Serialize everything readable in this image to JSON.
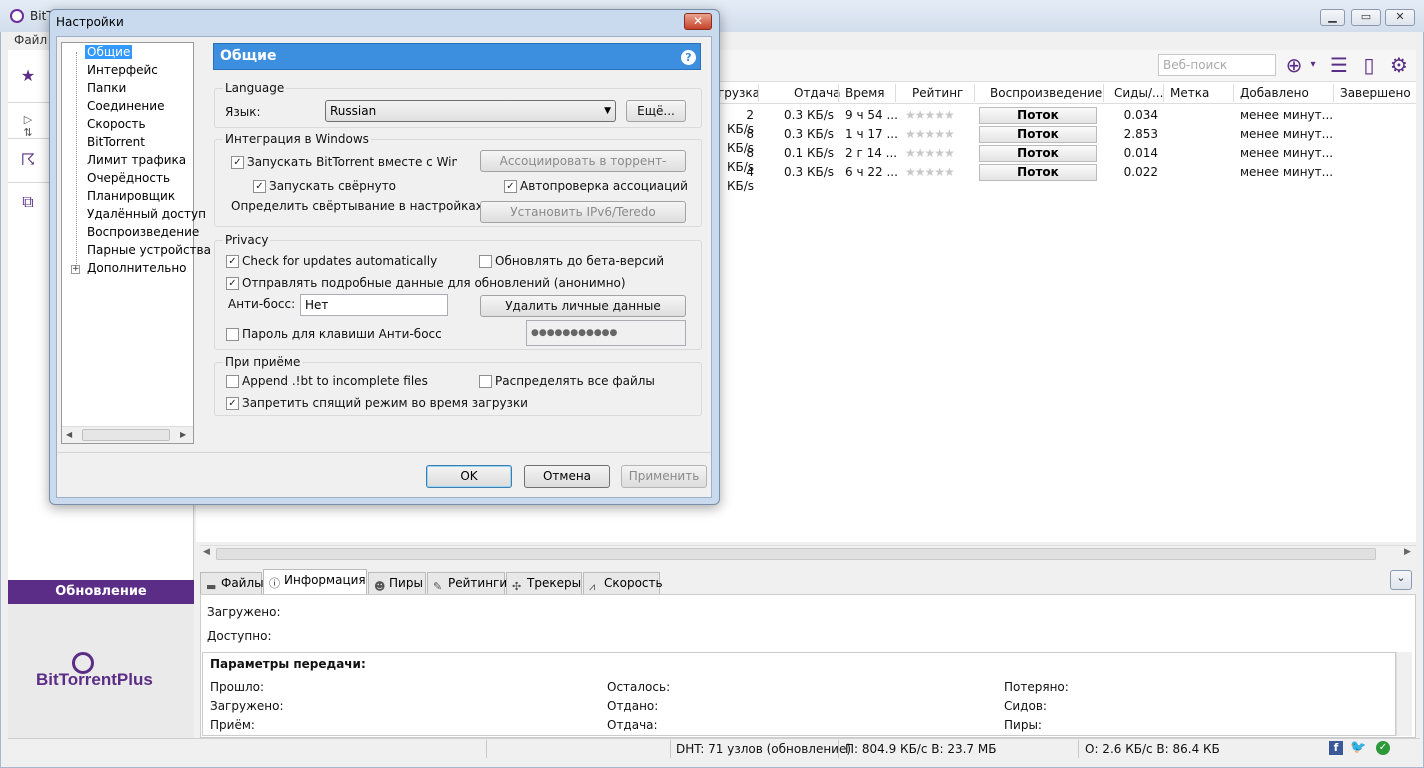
{
  "main": {
    "title": "BitTorrent",
    "menu_file": "Файл",
    "update_btn": "Обновление",
    "ad_logo": "BitTorrentPlus",
    "websearch_placeholder": "Веб-поиск"
  },
  "columns": [
    "грузка",
    "Отдача",
    "Время",
    "Рейтинг",
    "Воспроизведение",
    "Сиды/...",
    "Метка",
    "Добавлено",
    "Завершено"
  ],
  "rows": [
    {
      "dl": "2 КБ/s",
      "ul": "0.3 КБ/s",
      "time": "9 ч 54 ...",
      "stream": "Поток",
      "seeds": "0.034",
      "added": "менее минут..."
    },
    {
      "dl": "8 КБ/s",
      "ul": "0.3 КБ/s",
      "time": "1 ч 17 ...",
      "stream": "Поток",
      "seeds": "2.853",
      "added": "менее минут..."
    },
    {
      "dl": "8 КБ/s",
      "ul": "0.1 КБ/s",
      "time": "2 г 14 ...",
      "stream": "Поток",
      "seeds": "0.014",
      "added": "менее минут..."
    },
    {
      "dl": "4 КБ/s",
      "ul": "0.3 КБ/s",
      "time": "6 ч 22 ...",
      "stream": "Поток",
      "seeds": "0.022",
      "added": "менее минут..."
    }
  ],
  "stars": "★★★★★",
  "tabs": [
    "Файлы",
    "Информация",
    "Пиры",
    "Рейтинги",
    "Трекеры",
    "Скорость"
  ],
  "info": {
    "downloaded": "Загружено:",
    "available": "Доступно:",
    "params": "Параметры передачи:",
    "c1": [
      "Прошло:",
      "Загружено:",
      "Приём:"
    ],
    "c2": [
      "Осталось:",
      "Отдано:",
      "Отдача:"
    ],
    "c3": [
      "Потеряно:",
      "Сидов:",
      "Пиры:"
    ]
  },
  "status": {
    "dht": "DHT: 71 узлов  (обновление)",
    "down": "П: 804.9 КБ/с В: 23.7 МБ",
    "up": "О: 2.6 КБ/с В: 86.4 КБ"
  },
  "dialog": {
    "title": "Настройки",
    "tree": [
      "Общие",
      "Интерфейс",
      "Папки",
      "Соединение",
      "Скорость",
      "BitTorrent",
      "Лимит трафика",
      "Очерёдность",
      "Планировщик",
      "Удалённый доступ",
      "Воспроизведение",
      "Парные устройства",
      "Дополнительно"
    ],
    "panel_title": "Общие",
    "lang_group": "Language",
    "lang_label": "Язык:",
    "lang_value": "Russian",
    "more_btn": "Ещё...",
    "win_group": "Интеграция в Windows",
    "start_with_windows": "Запускать BitTorrent вместе с Windows",
    "start_minimized": "Запускать свёрнуто",
    "associate_btn": "Ассоциировать в торрент-файлами",
    "autocheck_assoc": "Автопроверка ассоциаций",
    "define_minimize": "Определить свёртывание в настройках",
    "ipv6_btn": "Установить IPv6/Teredo",
    "privacy_group": "Privacy",
    "check_updates": "Check for updates automatically",
    "beta_updates": "Обновлять до бета-версий",
    "send_data": "Отправлять подробные данные для обновлений (анонимно)",
    "boss_label": "Анти-босс:",
    "boss_value": "Нет",
    "delete_private_btn": "Удалить личные данные",
    "boss_password": "Пароль для клавиши Анти-босс",
    "password_value": "●●●●●●●●●●●",
    "recv_group": "При приёме",
    "append_bt": "Append .!bt to incomplete files",
    "prealloc": "Распределять все файлы",
    "no_sleep": "Запретить спящий режим во время загрузки",
    "ok": "OK",
    "cancel": "Отмена",
    "apply": "Применить"
  }
}
